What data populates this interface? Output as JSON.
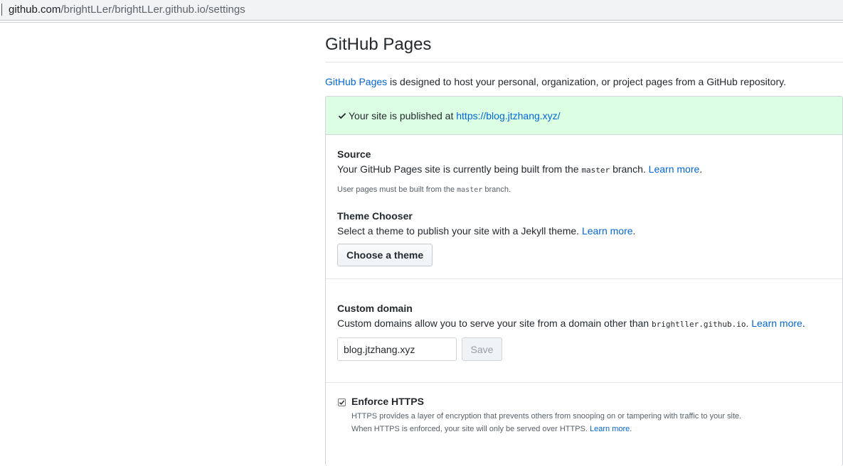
{
  "browser": {
    "url_host": "github.com",
    "url_path": "/brightLLer/brightLLer.github.io/settings"
  },
  "pages": {
    "title": "GitHub Pages",
    "intro_link": "GitHub Pages",
    "intro_text": " is designed to host your personal, organization, or project pages from a GitHub repository.",
    "published_prefix": "Your site is published at ",
    "published_url": "https://blog.jtzhang.xyz/",
    "source": {
      "title": "Source",
      "desc_prefix": "Your GitHub Pages site is currently being built from the ",
      "branch_code": "master",
      "desc_suffix": " branch. ",
      "learn_more": "Learn more",
      "period": ".",
      "note_prefix": "User pages must be built from the ",
      "note_code": "master",
      "note_suffix": " branch."
    },
    "theme": {
      "title": "Theme Chooser",
      "desc": "Select a theme to publish your site with a Jekyll theme. ",
      "learn_more": "Learn more",
      "period": ".",
      "button": "Choose a theme"
    },
    "custom_domain": {
      "title": "Custom domain",
      "desc_prefix": "Custom domains allow you to serve your site from a domain other than ",
      "domain_code": "brightller.github.io",
      "desc_suffix": ". ",
      "learn_more": "Learn more",
      "period": ".",
      "input_value": "blog.jtzhang.xyz",
      "save_label": "Save"
    },
    "https": {
      "title": "Enforce HTTPS",
      "checked": true,
      "line1": "HTTPS provides a layer of encryption that prevents others from snooping on or tampering with traffic to your site.",
      "line2": "When HTTPS is enforced, your site will only be served over HTTPS. ",
      "learn_more": "Learn more",
      "period": "."
    }
  },
  "colors": {
    "link": "#0366d6",
    "success_bg": "#dcffe4",
    "check": "#28a745"
  }
}
